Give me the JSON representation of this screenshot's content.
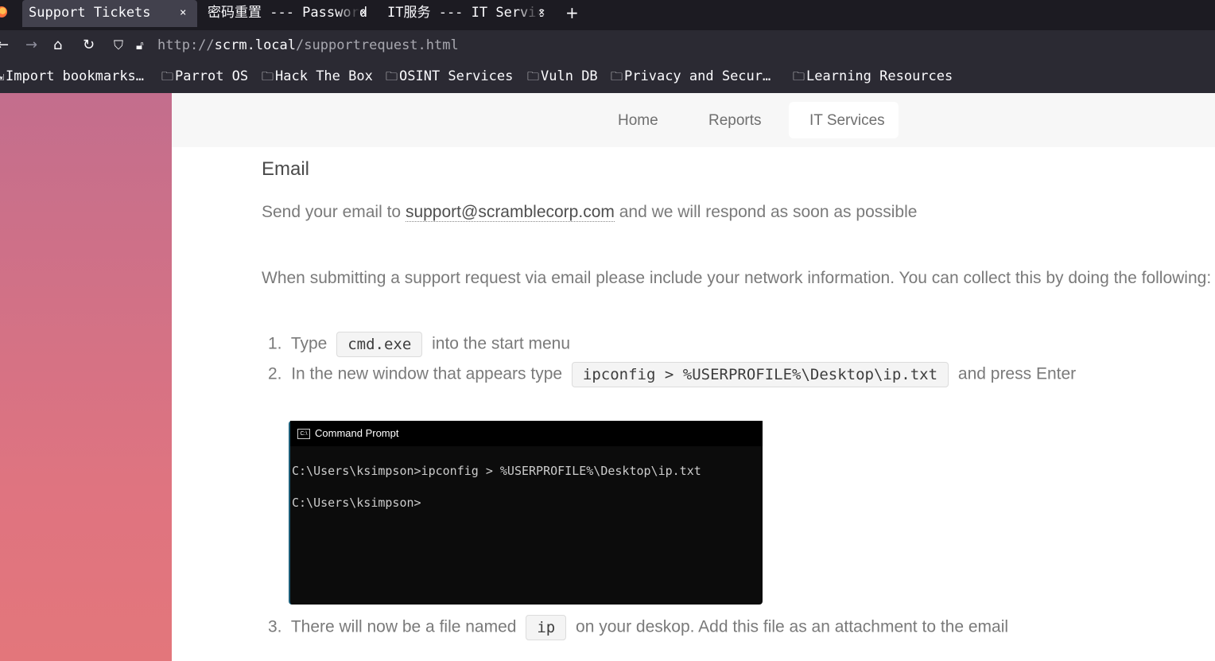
{
  "browser": {
    "tabs": [
      {
        "title": "Support Tickets",
        "close": "×"
      },
      {
        "title": "密码重置 --- Password",
        "close": "×"
      },
      {
        "title": "IT服务 --- IT Servic",
        "close": "×"
      }
    ],
    "new_tab": "+",
    "url_scheme": "http://",
    "url_host": "scrm.local",
    "url_path": "/supportrequest.html",
    "bookmarks": [
      "Import bookmarks…",
      "Parrot OS",
      "Hack The Box",
      "OSINT Services",
      "Vuln DB",
      "Privacy and Secur…",
      "Learning Resources"
    ]
  },
  "site_nav": {
    "home": "Home",
    "reports": "Reports",
    "it_services": "IT Services"
  },
  "content": {
    "heading": "Email",
    "send_prefix": "Send your email to",
    "email": "support@scramblecorp.com",
    "send_suffix": "and we will respond as soon as possible",
    "instructions": "When submitting a support request via email please include your network information. You can collect this by doing the following:",
    "step1_num": "1.",
    "step1_pre": "Type",
    "step1_code": "cmd.exe",
    "step1_post": "into the start menu",
    "step2_num": "2.",
    "step2_pre": "In the new window that appears type",
    "step2_code": "ipconfig > %USERPROFILE%\\Desktop\\ip.txt",
    "step2_post": "and press Enter",
    "step3_num": "3.",
    "step3_pre": "There will now be a file named",
    "step3_code": "ip",
    "step3_post": "on your deskop. Add this file as an attachment to the email"
  },
  "cmd_window": {
    "title": "Command Prompt",
    "icon_text": "C:\\",
    "line1": "C:\\Users\\ksimpson>ipconfig > %USERPROFILE%\\Desktop\\ip.txt",
    "line2": "C:\\Users\\ksimpson>"
  }
}
